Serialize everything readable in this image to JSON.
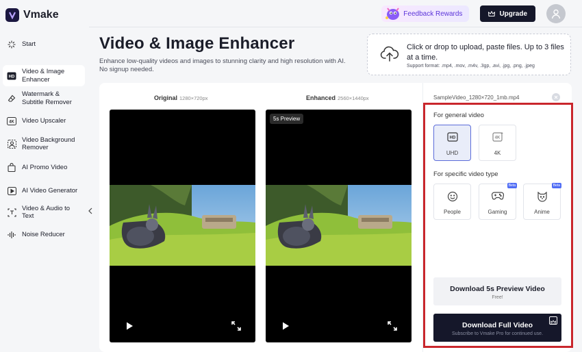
{
  "app": {
    "name": "Vmake"
  },
  "sidebar": {
    "items": [
      {
        "label": "Start",
        "icon": "sparkle-icon"
      },
      {
        "label": "Video & Image Enhancer",
        "icon": "hd-icon",
        "active": true
      },
      {
        "label": "Watermark & Subtitle Remover",
        "icon": "eraser-icon"
      },
      {
        "label": "Video Upscaler",
        "icon": "4k-icon"
      },
      {
        "label": "Video Background Remover",
        "icon": "person-cutout-icon"
      },
      {
        "label": "AI Promo Video",
        "icon": "bag-icon"
      },
      {
        "label": "AI Video Generator",
        "icon": "play-box-icon"
      },
      {
        "label": "Video & Audio to Text",
        "icon": "text-icon"
      },
      {
        "label": "Noise Reducer",
        "icon": "waveform-icon"
      }
    ]
  },
  "topbar": {
    "feedback_label": "Feedback Rewards",
    "upgrade_label": "Upgrade"
  },
  "page": {
    "title": "Video & Image Enhancer",
    "subtitle": "Enhance low-quality videos and images to stunning clarity and high resolution with AI. No signup needed."
  },
  "upload": {
    "main_text": "Click or drop to upload, paste files. Up to 3 files at a time.",
    "formats": "Support format: .mp4, .mov, .m4v, .3gp, .avi, .jpg, .png, .jpeg"
  },
  "compare": {
    "original_label": "Original",
    "original_res": "1280×720px",
    "enhanced_label": "Enhanced",
    "enhanced_res": "2560×1440px",
    "preview_badge": "5s Preview"
  },
  "settings": {
    "filename": "SampleVideo_1280×720_1mb.mp4",
    "general_label": "For general video",
    "general_options": [
      {
        "label": "UHD",
        "icon": "hd-icon",
        "selected": true
      },
      {
        "label": "4K",
        "icon": "4k-icon",
        "selected": false
      }
    ],
    "specific_label": "For specific video type",
    "specific_options": [
      {
        "label": "People",
        "icon": "smiley-icon",
        "beta": false
      },
      {
        "label": "Gaming",
        "icon": "gamepad-icon",
        "beta": true,
        "badge": "Beta"
      },
      {
        "label": "Anime",
        "icon": "anime-face-icon",
        "beta": true,
        "badge": "Beta"
      }
    ],
    "preview_button": {
      "label": "Download 5s Preview Video",
      "sub": "Free!"
    },
    "full_button": {
      "label": "Download Full Video",
      "sub": "Subscribe to Vmake Pro for continued use."
    }
  },
  "colors": {
    "accent": "#5b6cd9",
    "dark_button": "#15172a",
    "highlight_border": "#c9262c"
  }
}
